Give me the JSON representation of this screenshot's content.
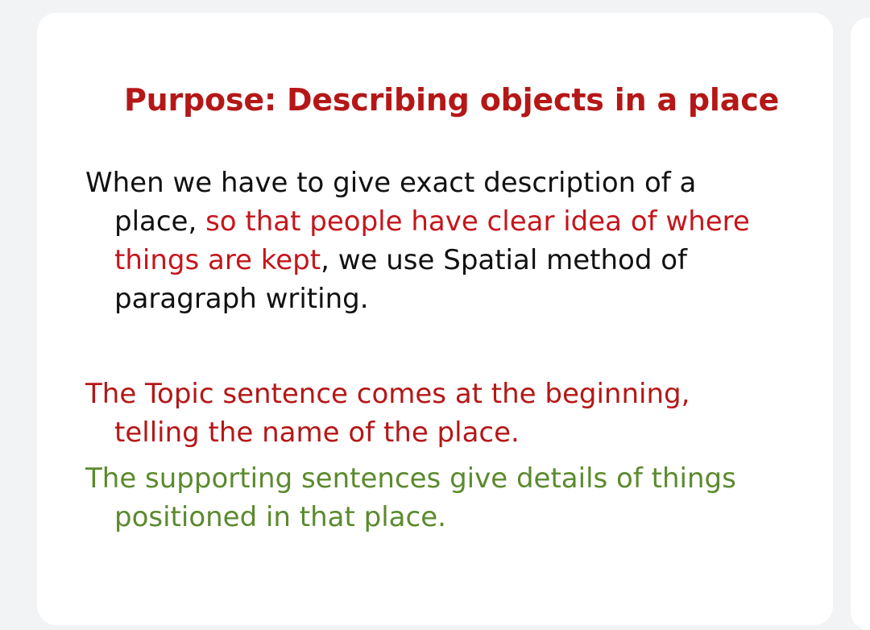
{
  "slide": {
    "title": "Purpose: Describing objects in a place",
    "paragraph1": {
      "line1": "When we have to give exact description of a",
      "line2_black": "place, ",
      "line2_red": "so that people have clear idea of where",
      "line3_red": "things are kept",
      "line3_black": ", we use Spatial method of",
      "line4": "paragraph writing."
    },
    "paragraph2": {
      "line1": "The Topic sentence comes at the beginning,",
      "line2": "telling the name of the place."
    },
    "paragraph3": {
      "line1": "The supporting sentences give details of things",
      "line2": "positioned in that place."
    }
  },
  "colors": {
    "title": "#b51717",
    "highlight_red": "#c4161c",
    "body_black": "#111111",
    "topic_red": "#b51717",
    "support_green": "#5b8a2e"
  }
}
